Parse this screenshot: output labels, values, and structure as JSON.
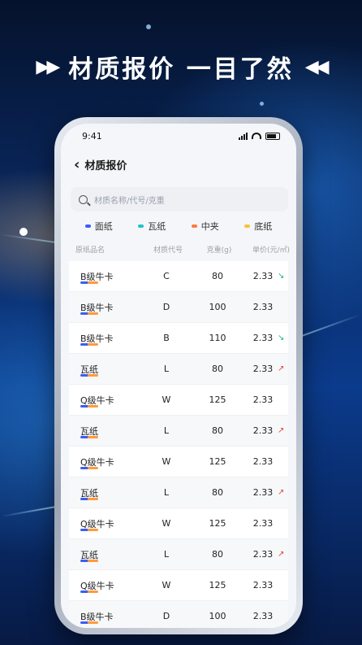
{
  "headline": {
    "title": "材质报价 一目了然",
    "left_icon": "double-chevron-right",
    "right_icon": "double-chevron-left"
  },
  "status_bar": {
    "time": "9:41"
  },
  "nav": {
    "back_icon": "chevron-left",
    "title": "材质报价"
  },
  "search": {
    "placeholder": "材质名称/代号/克重"
  },
  "legend": [
    {
      "label": "面纸",
      "color": "#3c5df5"
    },
    {
      "label": "瓦纸",
      "color": "#22c3c9"
    },
    {
      "label": "中夹",
      "color": "#ff7a3c"
    },
    {
      "label": "底纸",
      "color": "#f6c23e"
    }
  ],
  "table": {
    "headers": [
      "原纸品名",
      "材质代号",
      "克重(g)",
      "单价(元/㎡)"
    ],
    "rows": [
      {
        "name": "B级牛卡",
        "code": "C",
        "weight": "80",
        "price": "2.33",
        "trend": "down"
      },
      {
        "name": "B级牛卡",
        "code": "D",
        "weight": "100",
        "price": "2.33",
        "trend": ""
      },
      {
        "name": "B级牛卡",
        "code": "B",
        "weight": "110",
        "price": "2.33",
        "trend": "down"
      },
      {
        "name": "瓦纸",
        "code": "L",
        "weight": "80",
        "price": "2.33",
        "trend": "up"
      },
      {
        "name": "Q级牛卡",
        "code": "W",
        "weight": "125",
        "price": "2.33",
        "trend": ""
      },
      {
        "name": "瓦纸",
        "code": "L",
        "weight": "80",
        "price": "2.33",
        "trend": "up"
      },
      {
        "name": "Q级牛卡",
        "code": "W",
        "weight": "125",
        "price": "2.33",
        "trend": ""
      },
      {
        "name": "瓦纸",
        "code": "L",
        "weight": "80",
        "price": "2.33",
        "trend": "up"
      },
      {
        "name": "Q级牛卡",
        "code": "W",
        "weight": "125",
        "price": "2.33",
        "trend": ""
      },
      {
        "name": "瓦纸",
        "code": "L",
        "weight": "80",
        "price": "2.33",
        "trend": "up"
      },
      {
        "name": "Q级牛卡",
        "code": "W",
        "weight": "125",
        "price": "2.33",
        "trend": ""
      },
      {
        "name": "B级牛卡",
        "code": "D",
        "weight": "100",
        "price": "2.33",
        "trend": ""
      }
    ]
  }
}
